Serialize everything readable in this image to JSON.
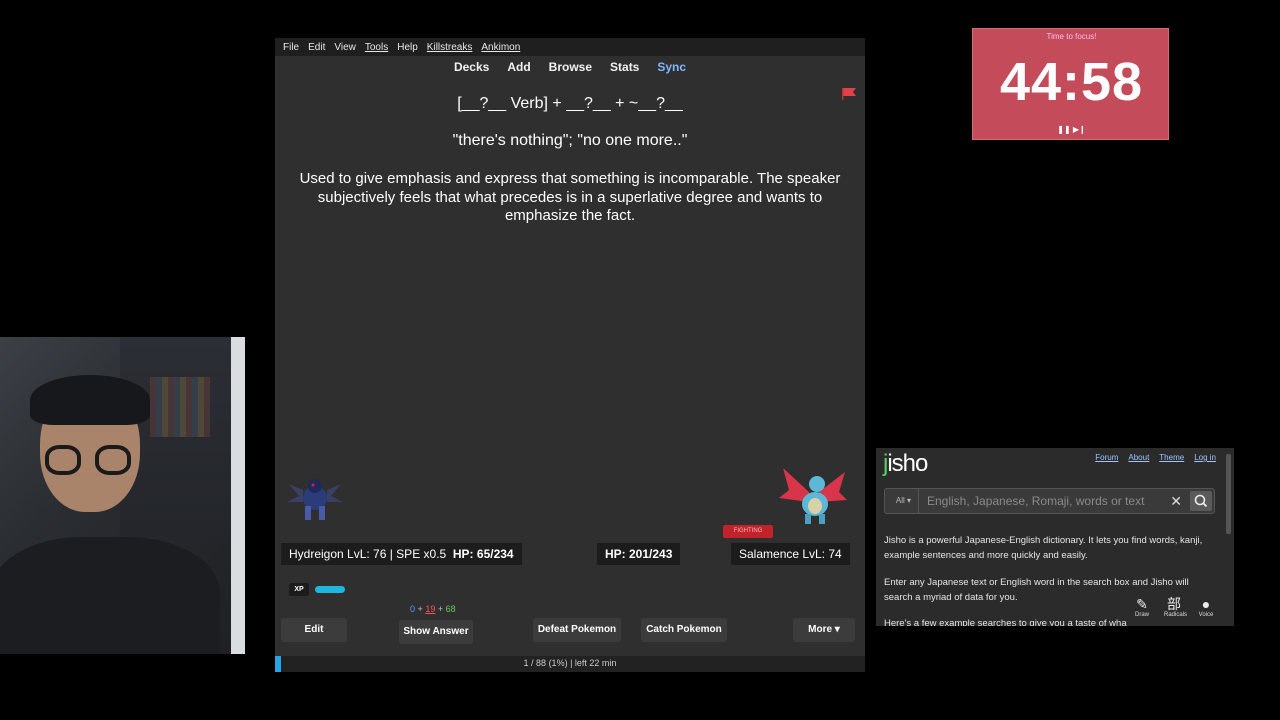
{
  "anki": {
    "menu": [
      "File",
      "Edit",
      "View",
      "Tools",
      "Help",
      "Killstreaks",
      "Ankimon"
    ],
    "tabs": [
      "Decks",
      "Add",
      "Browse",
      "Stats",
      "Sync"
    ],
    "card": {
      "pattern": "[__?__ Verb] + __?__ + ~__?__",
      "meaning": "\"there's nothing\"; \"no one more..\"",
      "explanation": "Used to give emphasis and express that something is incomparable. The speaker subjectively feels that what precedes is in a superlative degree and wants to emphasize the fact."
    },
    "battle": {
      "player": "Hydreigon LvL: 76 | SPE x0.5",
      "player_hp": "HP: 65/234",
      "enemy_hp": "HP: 201/243",
      "enemy": "Salamence LvL: 74",
      "type_badge": "FIGHTING",
      "xp_label": "XP",
      "xp_fraction": 0.3
    },
    "counts": {
      "new": "0",
      "plus1": "+",
      "learn": "19",
      "plus2": "+",
      "review": "68"
    },
    "buttons": {
      "edit": "Edit",
      "show_answer": "Show Answer",
      "defeat": "Defeat Pokemon",
      "catch": "Catch Pokemon",
      "more": "More ▾"
    },
    "footer": "1 / 88 (1%) | left 22 min"
  },
  "timer": {
    "label": "Time to focus!",
    "time": "44:58",
    "controls": "❚❚ ▶❙"
  },
  "jisho": {
    "logo_j": "j",
    "logo_rest": "isho",
    "links": [
      "Forum",
      "About",
      "Theme",
      "Log in"
    ],
    "search_scope": "All ▾",
    "search_placeholder": "English, Japanese, Romaji, words or text",
    "intro1": "Jisho is a powerful Japanese-English dictionary. It lets you find words, kanji, example sentences and more quickly and easily.",
    "intro2": "Enter any Japanese text or English word in the search box and Jisho will search a myriad of data for you.",
    "intro3": "Here's a few example searches to give you a taste of wha",
    "tools": [
      "Draw",
      "Radicals",
      "Voice"
    ]
  }
}
